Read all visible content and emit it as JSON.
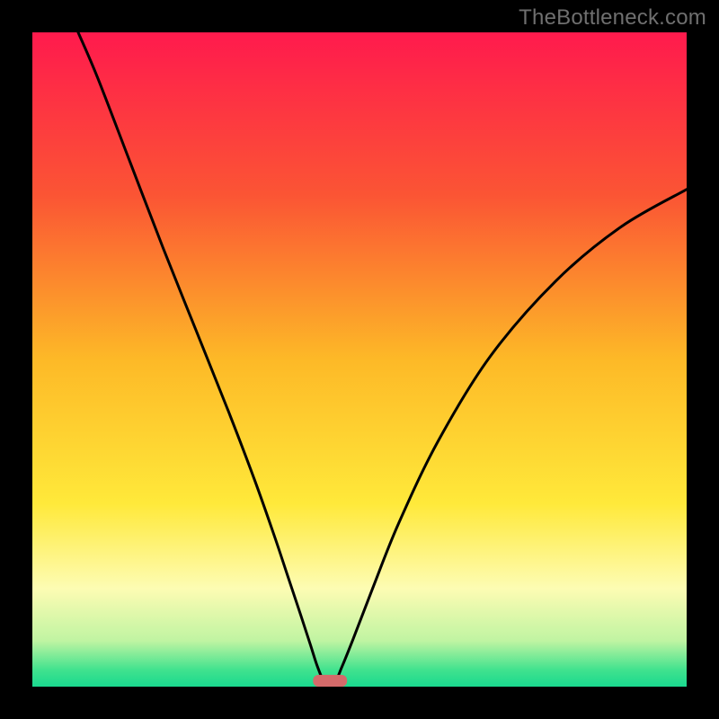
{
  "watermark": "TheBottleneck.com",
  "chart_data": {
    "type": "line",
    "title": "",
    "xlabel": "",
    "ylabel": "",
    "xlim": [
      0,
      100
    ],
    "ylim": [
      0,
      100
    ],
    "background_gradient": {
      "type": "vertical",
      "stops": [
        {
          "offset": 0.0,
          "color": "#ff1a4d"
        },
        {
          "offset": 0.25,
          "color": "#fb5534"
        },
        {
          "offset": 0.5,
          "color": "#fdb927"
        },
        {
          "offset": 0.72,
          "color": "#ffe93a"
        },
        {
          "offset": 0.85,
          "color": "#fdfcb3"
        },
        {
          "offset": 0.93,
          "color": "#c0f4a2"
        },
        {
          "offset": 0.975,
          "color": "#3fe28e"
        },
        {
          "offset": 1.0,
          "color": "#1ad98f"
        }
      ]
    },
    "frame": {
      "color": "#000000",
      "thickness_ratio": 0.045
    },
    "series": [
      {
        "name": "bottleneck-curve",
        "color": "#000000",
        "stroke_width": 3,
        "points": [
          {
            "x": 7.0,
            "y": 100.0
          },
          {
            "x": 10.0,
            "y": 93.0
          },
          {
            "x": 15.0,
            "y": 80.0
          },
          {
            "x": 20.0,
            "y": 67.0
          },
          {
            "x": 25.0,
            "y": 54.5
          },
          {
            "x": 30.0,
            "y": 42.0
          },
          {
            "x": 34.0,
            "y": 31.5
          },
          {
            "x": 37.0,
            "y": 23.0
          },
          {
            "x": 39.0,
            "y": 17.0
          },
          {
            "x": 41.0,
            "y": 11.0
          },
          {
            "x": 42.5,
            "y": 6.4
          },
          {
            "x": 43.6,
            "y": 3.0
          },
          {
            "x": 44.7,
            "y": 0.7
          },
          {
            "x": 46.2,
            "y": 0.7
          },
          {
            "x": 47.3,
            "y": 3.0
          },
          {
            "x": 49.0,
            "y": 7.2
          },
          {
            "x": 52.0,
            "y": 15.0
          },
          {
            "x": 56.0,
            "y": 25.0
          },
          {
            "x": 62.0,
            "y": 37.5
          },
          {
            "x": 70.0,
            "y": 50.5
          },
          {
            "x": 80.0,
            "y": 62.0
          },
          {
            "x": 90.0,
            "y": 70.3
          },
          {
            "x": 100.0,
            "y": 76.0
          }
        ]
      }
    ],
    "marker": {
      "name": "optimum-bar",
      "shape": "rounded-rect",
      "color": "#d46a6a",
      "x_center": 45.5,
      "width": 5.2,
      "y": 0,
      "height": 1.8
    }
  }
}
